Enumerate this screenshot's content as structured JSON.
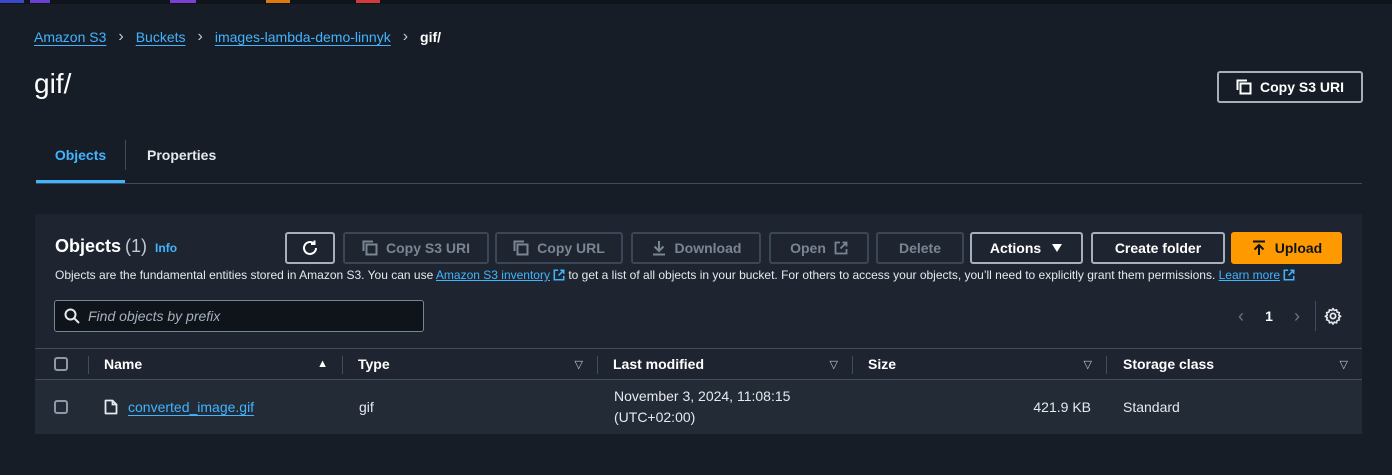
{
  "colors": {
    "accent": "#42b4ff",
    "primary_button": "#ff9900",
    "background": "#161d26",
    "panel": "#1e2530"
  },
  "breadcrumb": {
    "items": [
      "Amazon S3",
      "Buckets",
      "images-lambda-demo-linnyk"
    ],
    "current": "gif/"
  },
  "page": {
    "title": "gif/",
    "copy_s3_uri_label": "Copy S3 URI"
  },
  "tabs": [
    {
      "label": "Objects",
      "active": true
    },
    {
      "label": "Properties",
      "active": false
    }
  ],
  "objects_panel": {
    "heading": "Objects",
    "count": "(1)",
    "info_label": "Info",
    "toolbar": {
      "refresh_icon": "refresh-icon",
      "copy_s3_uri": "Copy S3 URI",
      "copy_url": "Copy URL",
      "download": "Download",
      "open": "Open",
      "delete": "Delete",
      "actions": "Actions",
      "create_folder": "Create folder",
      "upload": "Upload"
    },
    "description": {
      "part1": "Objects are the fundamental entities stored in Amazon S3. You can use ",
      "inventory_link": "Amazon S3 inventory",
      "part2": " to get a list of all objects in your bucket. For others to access your objects, you’ll need to explicitly grant them permissions. ",
      "learn_more": "Learn more"
    },
    "search": {
      "placeholder": "Find objects by prefix",
      "value": ""
    },
    "pagination": {
      "current_page": "1"
    },
    "table": {
      "columns": [
        "Name",
        "Type",
        "Last modified",
        "Size",
        "Storage class"
      ],
      "rows": [
        {
          "name": "converted_image.gif",
          "type": "gif",
          "last_modified_line1": "November 3, 2024, 11:08:15",
          "last_modified_line2": "(UTC+02:00)",
          "size": "421.9 KB",
          "storage_class": "Standard"
        }
      ]
    }
  }
}
